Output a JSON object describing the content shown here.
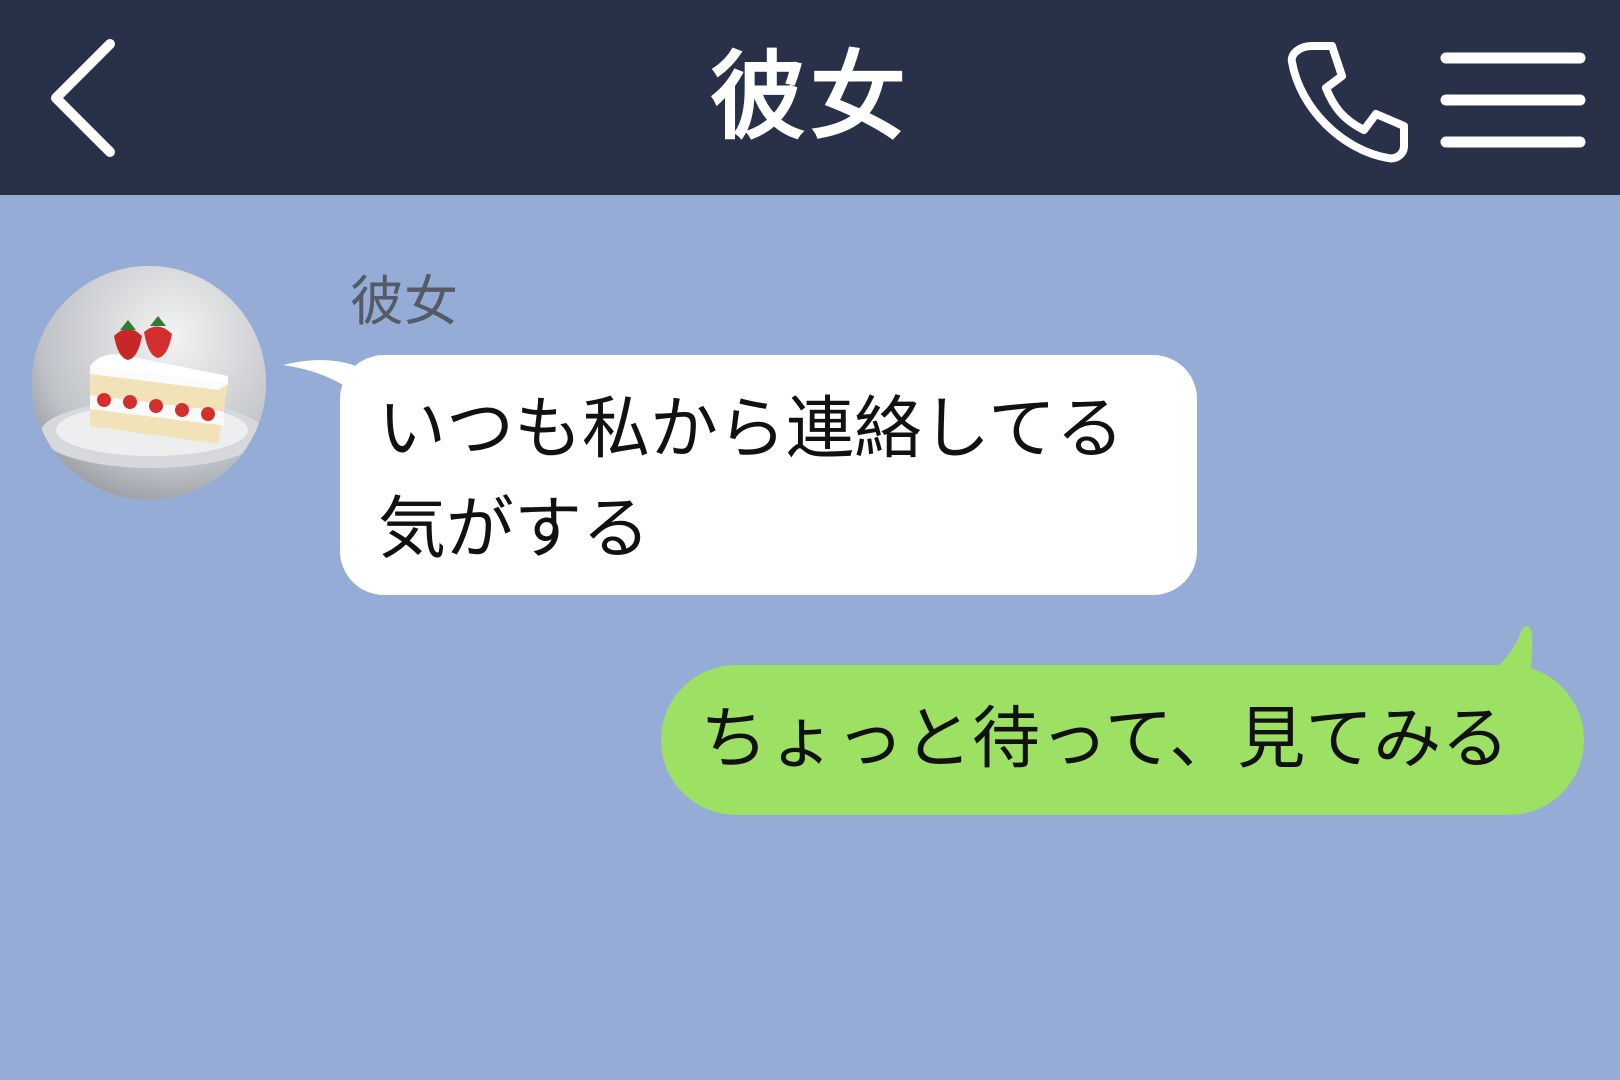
{
  "header": {
    "title": "彼女",
    "back_icon": "chevron-left-icon",
    "call_icon": "phone-icon",
    "menu_icon": "hamburger-menu-icon"
  },
  "messages": [
    {
      "direction": "incoming",
      "sender": "彼女",
      "avatar": "strawberry-shortcake-photo",
      "text": "いつも私から連絡してる気がする"
    },
    {
      "direction": "outgoing",
      "text": "ちょっと待って、見てみる"
    }
  ],
  "colors": {
    "header_bg": "#293148",
    "chat_bg": "#95acd6",
    "incoming_bubble": "#ffffff",
    "outgoing_bubble": "#9ce163"
  }
}
